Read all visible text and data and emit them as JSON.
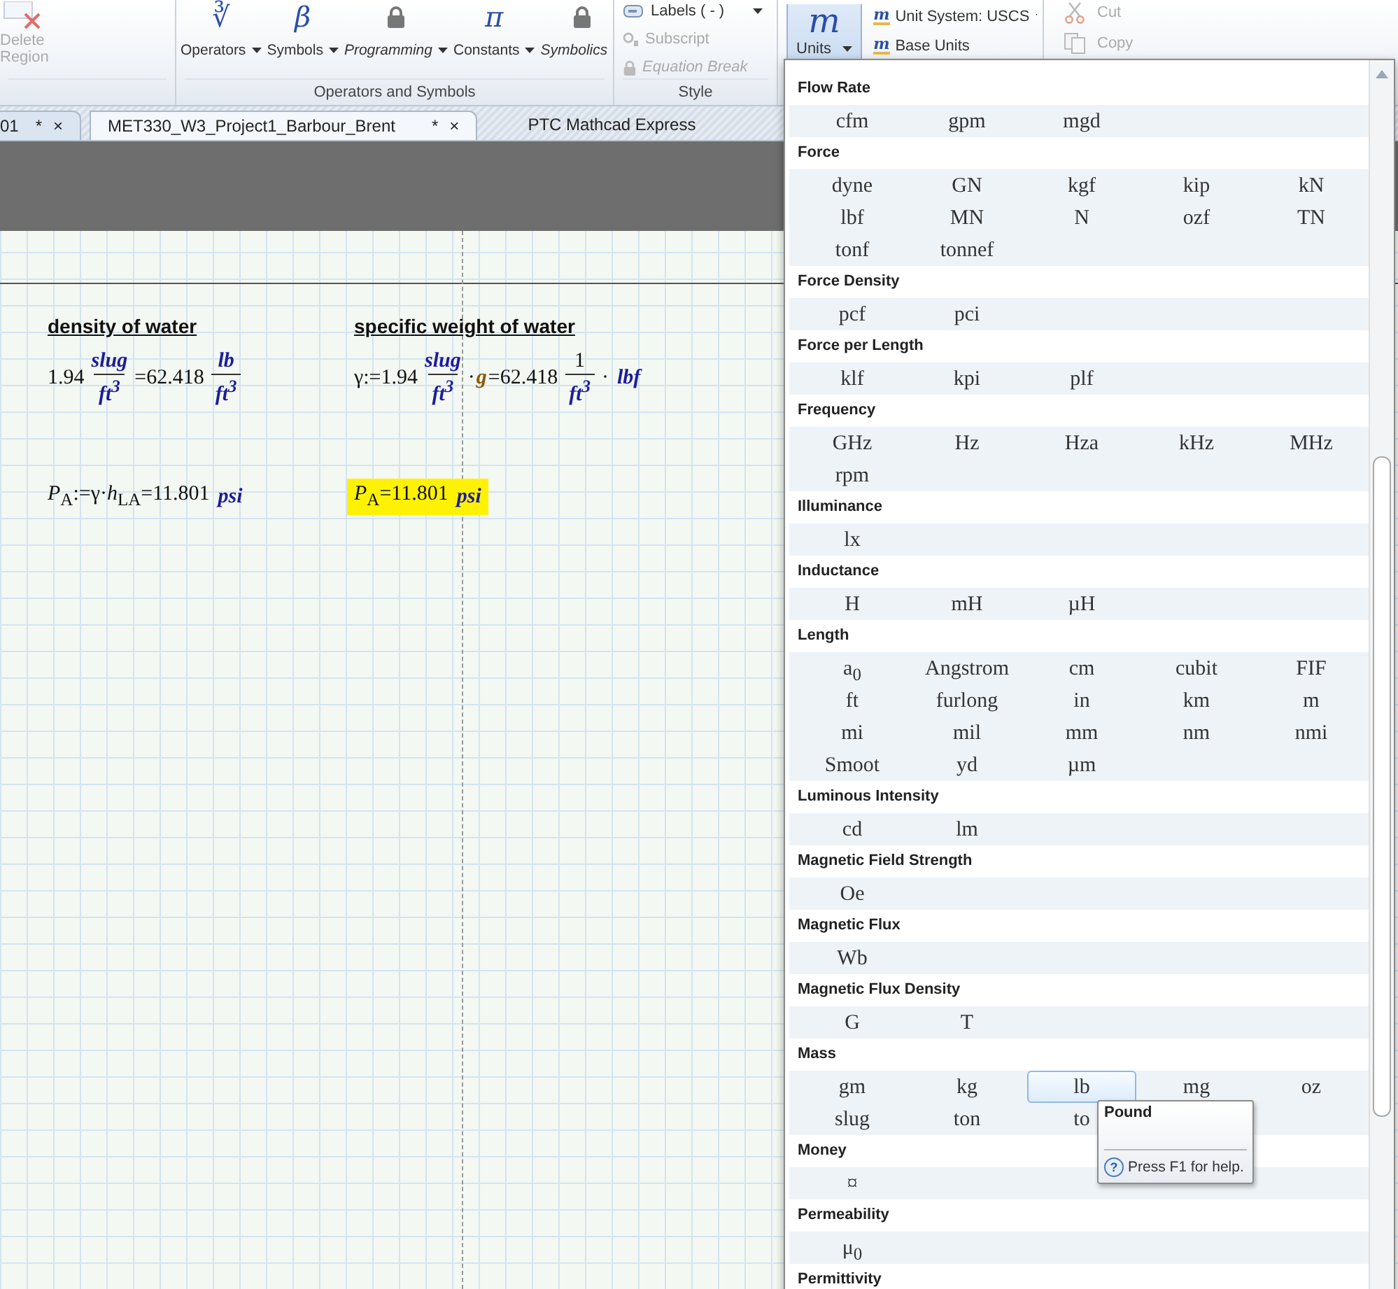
{
  "ribbon": {
    "delete_button": {
      "label": "Delete Region",
      "disabled": true
    },
    "operators_group": {
      "label": "Operators and Symbols",
      "buttons": [
        {
          "label": "Operators",
          "icon_text": "∛",
          "locked": false
        },
        {
          "label": "Symbols",
          "icon_text": "β",
          "locked": false
        },
        {
          "label": "Programming",
          "locked": true
        },
        {
          "label": "Constants",
          "icon_text": "π",
          "locked": false
        },
        {
          "label": "Symbolics",
          "locked": true
        }
      ]
    },
    "style_group": {
      "label": "Style",
      "items": [
        {
          "label": "Labels  ( - )",
          "kind": "labels",
          "disabled": false
        },
        {
          "label": "Subscript",
          "kind": "subscript",
          "disabled": true
        },
        {
          "label": "Equation Break",
          "kind": "locked",
          "disabled": true
        }
      ]
    },
    "units_group": {
      "button": {
        "icon_text": "m",
        "label": "Units",
        "selected": true
      },
      "unit_system": {
        "icon_text": "m",
        "label": "Unit System:  USCS"
      },
      "base_units": {
        "icon_text": "m",
        "label": "Base Units"
      }
    },
    "clipboard_group": {
      "items": [
        {
          "label": "Cut",
          "kind": "cut",
          "disabled": true
        },
        {
          "label": "Copy",
          "kind": "copy",
          "disabled": true
        }
      ]
    }
  },
  "document_tabs": [
    {
      "label": "01",
      "modified": "*",
      "close": "×",
      "selected": false
    },
    {
      "label": "MET330_W3_Project1_Barbour_Brent",
      "modified": "*",
      "close": "×",
      "selected": true
    }
  ],
  "app_title": "PTC Mathcad Express",
  "worksheet": {
    "regions": [
      {
        "kind": "heading",
        "text": "density of water"
      },
      {
        "kind": "heading",
        "text": "specific weight of water"
      },
      {
        "kind": "math",
        "highlighted": false,
        "parts": [
          {
            "kind": "plain",
            "text": "1.94"
          },
          {
            "kind": "frac",
            "num": {
              "kind": "unit",
              "text": "slug"
            },
            "den": {
              "kind": "unit",
              "text": "ft$^{3}$"
            }
          },
          {
            "kind": "plain",
            "text": "=62.418"
          },
          {
            "kind": "frac",
            "num": {
              "kind": "unit",
              "text": "lb"
            },
            "den": {
              "kind": "unit",
              "text": "ft$^{3}$"
            }
          }
        ]
      },
      {
        "kind": "math",
        "highlighted": false,
        "parts": [
          {
            "kind": "plain",
            "text": "γ:=1.94"
          },
          {
            "kind": "frac",
            "num": {
              "kind": "unit",
              "text": "slug"
            },
            "den": {
              "kind": "unit",
              "text": "ft$^{3}$"
            }
          },
          {
            "kind": "plain",
            "text": "·"
          },
          {
            "kind": "var",
            "text": "g"
          },
          {
            "kind": "plain",
            "text": "=62.418"
          },
          {
            "kind": "frac",
            "num": {
              "kind": "plain",
              "text": "1"
            },
            "den": {
              "kind": "unit",
              "text": "ft$^{3}$"
            }
          },
          {
            "kind": "plain",
            "text": "·"
          },
          {
            "kind": "unit",
            "text": "lbf"
          }
        ]
      },
      {
        "kind": "math",
        "highlighted": false,
        "parts": [
          {
            "kind": "plain",
            "text": "*P*$_{A}$:=γ·*h*$_{LA}$=11.801"
          },
          {
            "kind": "unit",
            "text": "psi"
          }
        ]
      },
      {
        "kind": "math",
        "highlighted": true,
        "parts": [
          {
            "kind": "plain",
            "text": "*P*$_{A}$=11.801"
          },
          {
            "kind": "unit",
            "text": "psi"
          }
        ]
      }
    ]
  },
  "units_menu": {
    "categories": [
      {
        "name": "Flow Rate",
        "units": [
          {
            "label": "cfm",
            "selected": false
          },
          {
            "label": "gpm",
            "selected": false
          },
          {
            "label": "mgd",
            "selected": false
          }
        ]
      },
      {
        "name": "Force",
        "units": [
          {
            "label": "dyne",
            "selected": false
          },
          {
            "label": "GN",
            "selected": false
          },
          {
            "label": "kgf",
            "selected": false
          },
          {
            "label": "kip",
            "selected": false
          },
          {
            "label": "kN",
            "selected": false
          },
          {
            "label": "lbf",
            "selected": false
          },
          {
            "label": "MN",
            "selected": false
          },
          {
            "label": "N",
            "selected": false
          },
          {
            "label": "ozf",
            "selected": false
          },
          {
            "label": "TN",
            "selected": false
          },
          {
            "label": "tonf",
            "selected": false
          },
          {
            "label": "tonnef",
            "selected": false
          }
        ]
      },
      {
        "name": "Force Density",
        "units": [
          {
            "label": "pcf",
            "selected": false
          },
          {
            "label": "pci",
            "selected": false
          }
        ]
      },
      {
        "name": "Force per Length",
        "units": [
          {
            "label": "klf",
            "selected": false
          },
          {
            "label": "kpi",
            "selected": false
          },
          {
            "label": "plf",
            "selected": false
          }
        ]
      },
      {
        "name": "Frequency",
        "units": [
          {
            "label": "GHz",
            "selected": false
          },
          {
            "label": "Hz",
            "selected": false
          },
          {
            "label": "Hza",
            "selected": false
          },
          {
            "label": "kHz",
            "selected": false
          },
          {
            "label": "MHz",
            "selected": false
          },
          {
            "label": "rpm",
            "selected": false
          }
        ]
      },
      {
        "name": "Illuminance",
        "units": [
          {
            "label": "lx",
            "selected": false
          }
        ]
      },
      {
        "name": "Inductance",
        "units": [
          {
            "label": "H",
            "selected": false
          },
          {
            "label": "mH",
            "selected": false
          },
          {
            "label": "µH",
            "selected": false
          }
        ]
      },
      {
        "name": "Length",
        "units": [
          {
            "label": "a$_{0}$",
            "selected": false
          },
          {
            "label": "Angstrom",
            "selected": false
          },
          {
            "label": "cm",
            "selected": false
          },
          {
            "label": "cubit",
            "selected": false
          },
          {
            "label": "FIF",
            "selected": false
          },
          {
            "label": "ft",
            "selected": false
          },
          {
            "label": "furlong",
            "selected": false
          },
          {
            "label": "in",
            "selected": false
          },
          {
            "label": "km",
            "selected": false
          },
          {
            "label": "m",
            "selected": false
          },
          {
            "label": "mi",
            "selected": false
          },
          {
            "label": "mil",
            "selected": false
          },
          {
            "label": "mm",
            "selected": false
          },
          {
            "label": "nm",
            "selected": false
          },
          {
            "label": "nmi",
            "selected": false
          },
          {
            "label": "Smoot",
            "selected": false
          },
          {
            "label": "yd",
            "selected": false
          },
          {
            "label": "µm",
            "selected": false
          }
        ]
      },
      {
        "name": "Luminous Intensity",
        "units": [
          {
            "label": "cd",
            "selected": false
          },
          {
            "label": "lm",
            "selected": false
          }
        ]
      },
      {
        "name": "Magnetic Field Strength",
        "units": [
          {
            "label": "Oe",
            "selected": false
          }
        ]
      },
      {
        "name": "Magnetic Flux",
        "units": [
          {
            "label": "Wb",
            "selected": false
          }
        ]
      },
      {
        "name": "Magnetic Flux Density",
        "units": [
          {
            "label": "G",
            "selected": false
          },
          {
            "label": "T",
            "selected": false
          }
        ]
      },
      {
        "name": "Mass",
        "units": [
          {
            "label": "gm",
            "selected": false
          },
          {
            "label": "kg",
            "selected": false
          },
          {
            "label": "lb",
            "selected": true
          },
          {
            "label": "mg",
            "selected": false
          },
          {
            "label": "oz",
            "selected": false
          },
          {
            "label": "slug",
            "selected": false
          },
          {
            "label": "ton",
            "selected": false
          },
          {
            "label": "to",
            "selected": false
          }
        ]
      },
      {
        "name": "Money",
        "units": [
          {
            "label": "¤",
            "selected": false
          }
        ]
      },
      {
        "name": "Permeability",
        "units": [
          {
            "label": "μ$_{0}$",
            "selected": false
          }
        ]
      },
      {
        "name": "Permittivity"
      }
    ],
    "tooltip": {
      "title": "Pound",
      "help_icon": "?",
      "help": "Press F1 for help."
    }
  }
}
